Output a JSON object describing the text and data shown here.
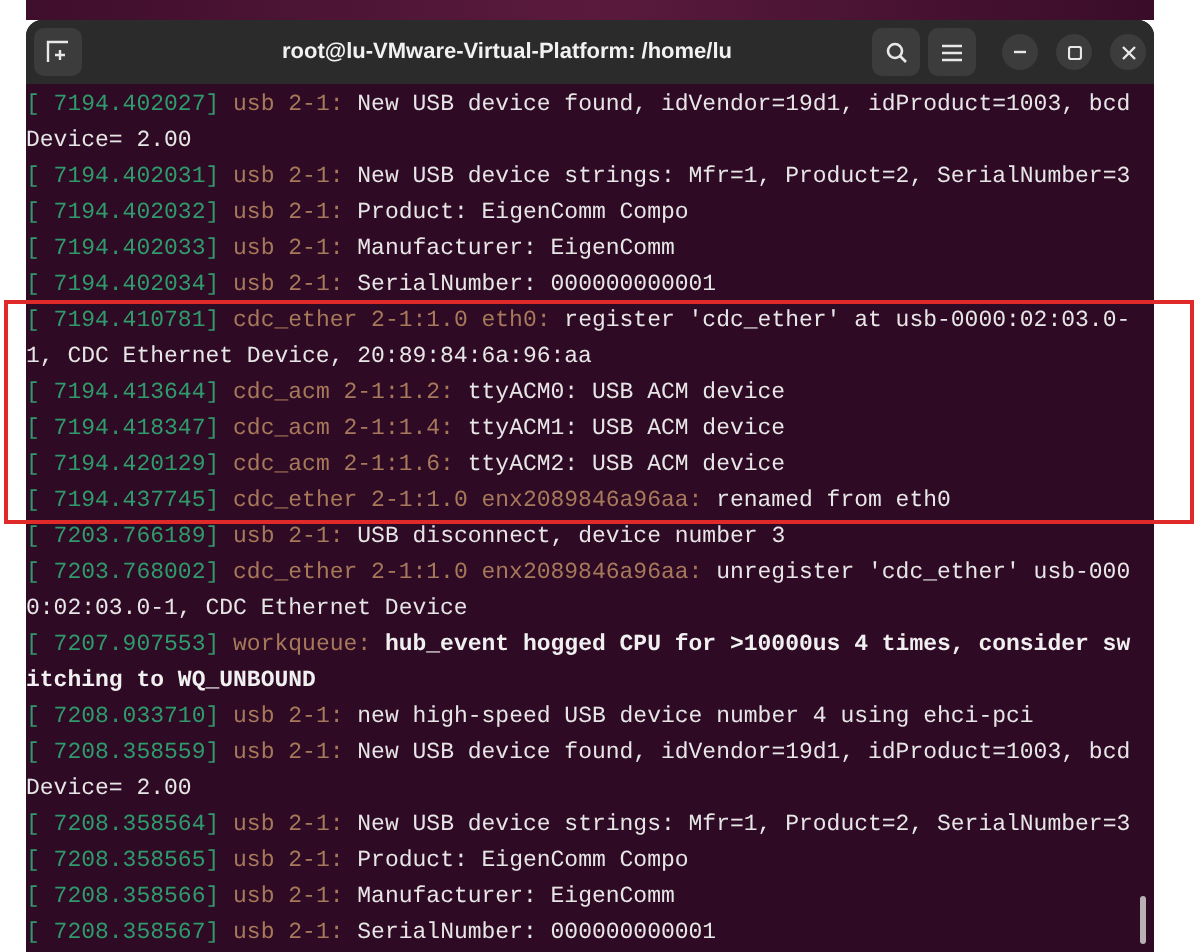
{
  "window": {
    "title": "root@lu-VMware-Virtual-Platform: /home/lu"
  },
  "log": [
    {
      "highlighted": false,
      "lines": [
        {
          "time": "[ 7194.402027]",
          "source": "usb 2-1:",
          "message": "New USB device found, idVendor=19d1, idProduct=1003, bcdDevice= 2.00",
          "bold": false
        },
        {
          "time": "[ 7194.402031]",
          "source": "usb 2-1:",
          "message": "New USB device strings: Mfr=1, Product=2, SerialNumber=3",
          "bold": false
        },
        {
          "time": "[ 7194.402032]",
          "source": "usb 2-1:",
          "message": "Product: EigenComm Compo",
          "bold": false
        },
        {
          "time": "[ 7194.402033]",
          "source": "usb 2-1:",
          "message": "Manufacturer: EigenComm",
          "bold": false
        },
        {
          "time": "[ 7194.402034]",
          "source": "usb 2-1:",
          "message": "SerialNumber: 000000000001",
          "bold": false
        }
      ]
    },
    {
      "highlighted": true,
      "lines": [
        {
          "time": "[ 7194.410781]",
          "source": "cdc_ether 2-1:1.0 eth0:",
          "message": "register 'cdc_ether' at usb-0000:02:03.0-1, CDC Ethernet Device, 20:89:84:6a:96:aa",
          "bold": false
        },
        {
          "time": "[ 7194.413644]",
          "source": "cdc_acm 2-1:1.2:",
          "message": "ttyACM0: USB ACM device",
          "bold": false
        },
        {
          "time": "[ 7194.418347]",
          "source": "cdc_acm 2-1:1.4:",
          "message": "ttyACM1: USB ACM device",
          "bold": false
        },
        {
          "time": "[ 7194.420129]",
          "source": "cdc_acm 2-1:1.6:",
          "message": "ttyACM2: USB ACM device",
          "bold": false
        },
        {
          "time": "[ 7194.437745]",
          "source": "cdc_ether 2-1:1.0 enx2089846a96aa:",
          "message": "renamed from eth0",
          "bold": false
        }
      ]
    },
    {
      "highlighted": false,
      "lines": [
        {
          "time": "[ 7203.766189]",
          "source": "usb 2-1:",
          "message": "USB disconnect, device number 3",
          "bold": false
        },
        {
          "time": "[ 7203.768002]",
          "source": "cdc_ether 2-1:1.0 enx2089846a96aa:",
          "message": "unregister 'cdc_ether' usb-0000:02:03.0-1, CDC Ethernet Device",
          "bold": false
        },
        {
          "time": "[ 7207.907553]",
          "source": "workqueue:",
          "message": "hub_event hogged CPU for >10000us 4 times, consider switching to WQ_UNBOUND",
          "bold": true
        },
        {
          "time": "[ 7208.033710]",
          "source": "usb 2-1:",
          "message": "new high-speed USB device number 4 using ehci-pci",
          "bold": false
        },
        {
          "time": "[ 7208.358559]",
          "source": "usb 2-1:",
          "message": "New USB device found, idVendor=19d1, idProduct=1003, bcdDevice= 2.00",
          "bold": false
        },
        {
          "time": "[ 7208.358564]",
          "source": "usb 2-1:",
          "message": "New USB device strings: Mfr=1, Product=2, SerialNumber=3",
          "bold": false
        },
        {
          "time": "[ 7208.358565]",
          "source": "usb 2-1:",
          "message": "Product: EigenComm Compo",
          "bold": false
        },
        {
          "time": "[ 7208.358566]",
          "source": "usb 2-1:",
          "message": "Manufacturer: EigenComm",
          "bold": false
        },
        {
          "time": "[ 7208.358567]",
          "source": "usb 2-1:",
          "message": "SerialNumber: 000000000001",
          "bold": false
        }
      ]
    }
  ]
}
